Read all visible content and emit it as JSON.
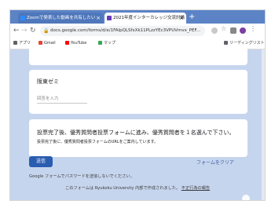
{
  "browser": {
    "tabs": [
      {
        "label": "Zoomで発表した動画を共有したい",
        "active": false,
        "favicon_color": "#2d8cff"
      },
      {
        "label": "2021年度インターカレッジ交流討論",
        "active": true,
        "favicon_color": "#673ab7"
      }
    ],
    "new_tab_label": "+",
    "close_label": "×",
    "url": "docs.google.com/forms/d/e/1FAIpQLSfxXk11PLzzYEc3VPUVmvx_PEF...",
    "bookmarks": [
      {
        "label": "アプリ",
        "color": "#5f6368"
      },
      {
        "label": "Gmail",
        "color": "#ea4335"
      },
      {
        "label": "YouTube",
        "color": "#ff0000"
      },
      {
        "label": "マップ",
        "color": "#34a853"
      }
    ],
    "reading_list": "リーディングリスト"
  },
  "form": {
    "question": {
      "title": "阪東ゼミ",
      "placeholder": "回答を入力"
    },
    "notice": {
      "main": "投票完了後、優秀質問者投票フォームに進み、優秀質問者を１名選んで下さい。",
      "sub": "投票完了後に、優秀質問者投票フォームのURLをご案内しています。"
    },
    "submit_label": "送信",
    "clear_label": "フォームをクリア",
    "password_warning": "Google フォームでパスワードを送信しないでください。",
    "footer_text": "このフォームは Ryukoku University 内部で作成されました。",
    "footer_link": "不正行為の報告"
  },
  "colors": {
    "accent": "#2a5db0",
    "page_bg": "#c6d5ee",
    "tabbar": "#5b83c6"
  }
}
